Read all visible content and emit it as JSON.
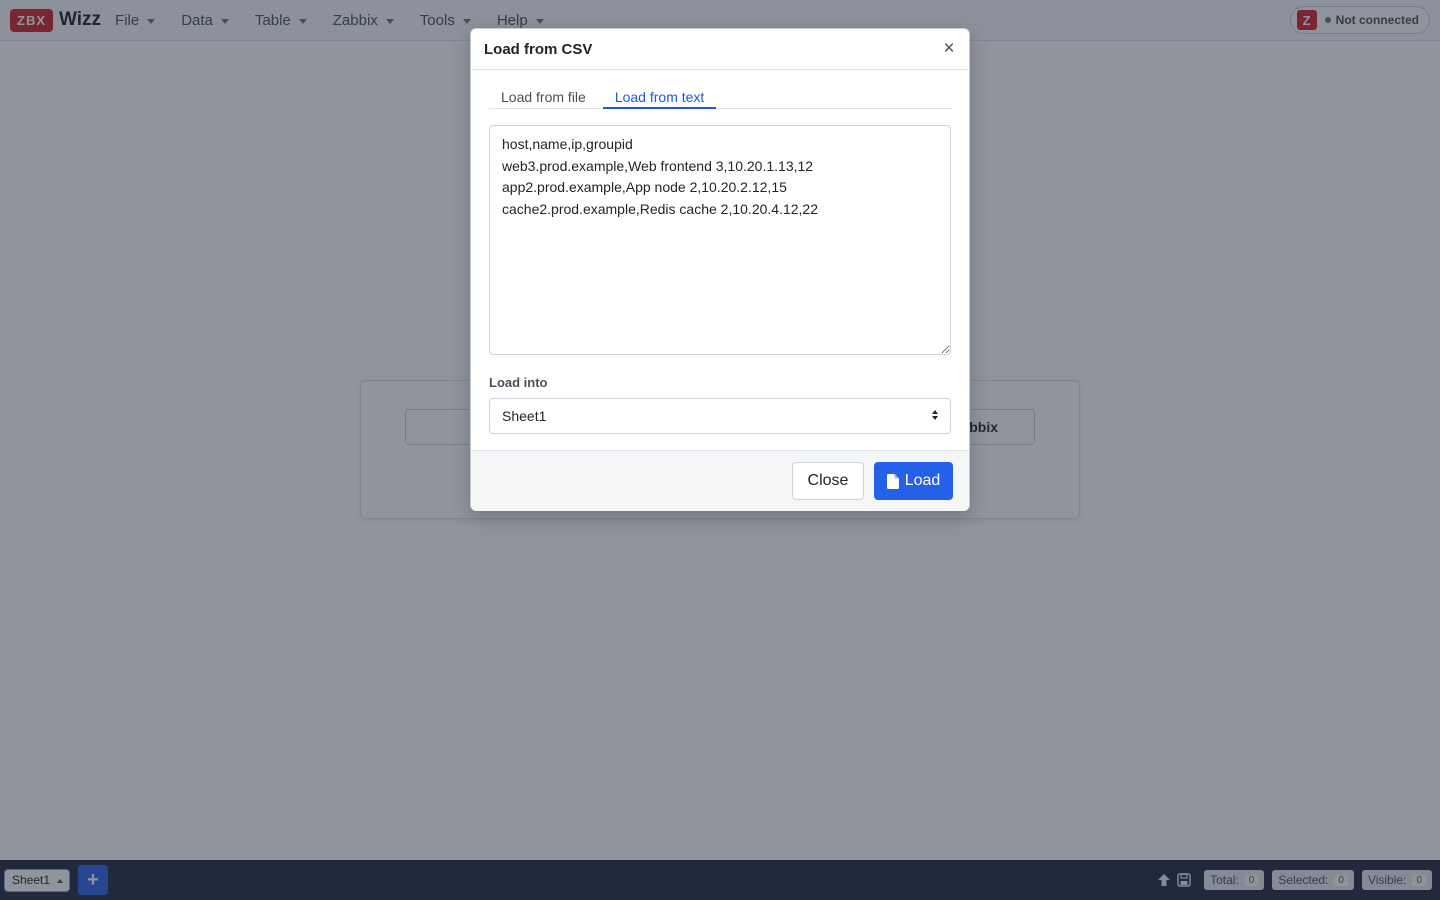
{
  "navbar": {
    "brand_badge": "ZBX",
    "brand_name": "Wizz",
    "menu": [
      "File",
      "Data",
      "Table",
      "Zabbix",
      "Tools",
      "Help"
    ],
    "connection": {
      "icon_letter": "Z",
      "status": "Not connected"
    }
  },
  "background_card": {
    "right_button_fragment": "bbix"
  },
  "modal": {
    "title": "Load from CSV",
    "close_glyph": "×",
    "tabs": [
      "Load from file",
      "Load from text"
    ],
    "active_tab": "Load from text",
    "csv_text": "host,name,ip,groupid\nweb3.prod.example,Web frontend 3,10.20.1.13,12\napp2.prod.example,App node 2,10.20.2.12,15\ncache2.prod.example,Redis cache 2,10.20.4.12,22",
    "load_into_label": "Load into",
    "load_into_value": "Sheet1",
    "close_button": "Close",
    "load_button": "Load"
  },
  "bottombar": {
    "sheet_tab": "Sheet1",
    "add_sheet": "+",
    "stats": {
      "total_label": "Total:",
      "total": "0",
      "selected_label": "Selected:",
      "selected": "0",
      "visible_label": "Visible:",
      "visible": "0"
    }
  },
  "colors": {
    "brand_red": "#d1222a",
    "primary_blue": "#2560e8",
    "bottombar_bg": "#212b3f"
  },
  "icons": [
    "caret-down-icon",
    "close-icon",
    "upload-arrow-icon",
    "save-disk-icon",
    "file-icon",
    "select-arrows-icon"
  ]
}
